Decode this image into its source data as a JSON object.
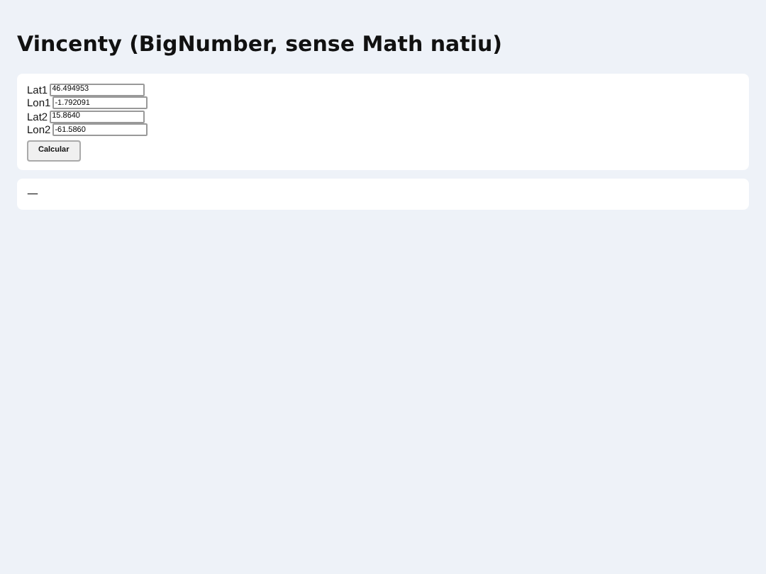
{
  "title": "Vincenty (BigNumber, sense Math natiu)",
  "fields": [
    {
      "label": "Lat1",
      "value": "46.494953"
    },
    {
      "label": "Lon1",
      "value": "-1.792091"
    },
    {
      "label": "Lat2",
      "value": "15.8640"
    },
    {
      "label": "Lon2",
      "value": "-61.5860"
    }
  ],
  "button": "Calcular",
  "result": "—"
}
